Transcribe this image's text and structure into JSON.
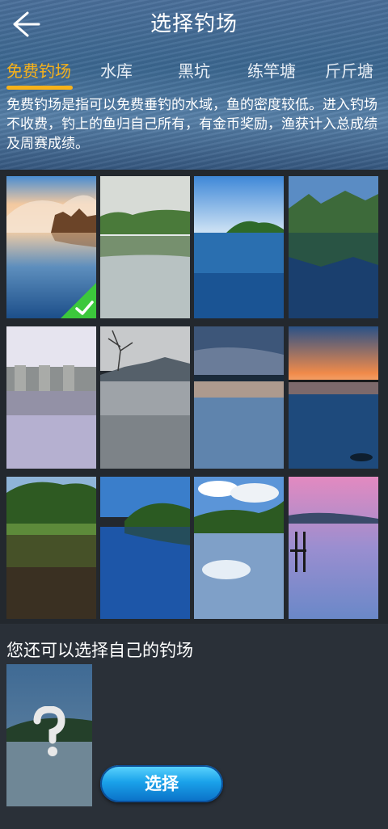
{
  "header": {
    "title": "选择钓场"
  },
  "tabs": [
    {
      "label": "免费钓场",
      "active": true
    },
    {
      "label": "水库",
      "active": false
    },
    {
      "label": "黑坑",
      "active": false
    },
    {
      "label": "练竿塘",
      "active": false
    },
    {
      "label": "斤斤塘",
      "active": false
    }
  ],
  "description": "免费钓场是指可以免费垂钓的水域，鱼的密度较低。进入钓场不收费，钓上的鱼归自己所有，有金币奖励，渔获计入总成绩及周赛成绩。",
  "scenes": [
    {
      "name": "lake-sunset-cabin",
      "selected": true
    },
    {
      "name": "lake-cloudy-hills",
      "selected": false
    },
    {
      "name": "lake-island-trees",
      "selected": false
    },
    {
      "name": "mountain-lake",
      "selected": false
    },
    {
      "name": "dam-reservoir",
      "selected": false
    },
    {
      "name": "misty-lake-tree",
      "selected": false
    },
    {
      "name": "dusk-lake",
      "selected": false
    },
    {
      "name": "orange-horizon-lake",
      "selected": false
    },
    {
      "name": "forest-pond",
      "selected": false
    },
    {
      "name": "blue-lake-forest",
      "selected": false
    },
    {
      "name": "cloud-reflection-lake",
      "selected": false
    },
    {
      "name": "pink-sky-pier",
      "selected": false
    }
  ],
  "custom": {
    "label": "您还可以选择自己的钓场",
    "placeholder_icon": "question-mark-icon"
  },
  "select_button": {
    "label": "选择"
  },
  "colors": {
    "accent": "#f8b21a",
    "check": "#3cc83c",
    "button": "#1aa2ea"
  }
}
